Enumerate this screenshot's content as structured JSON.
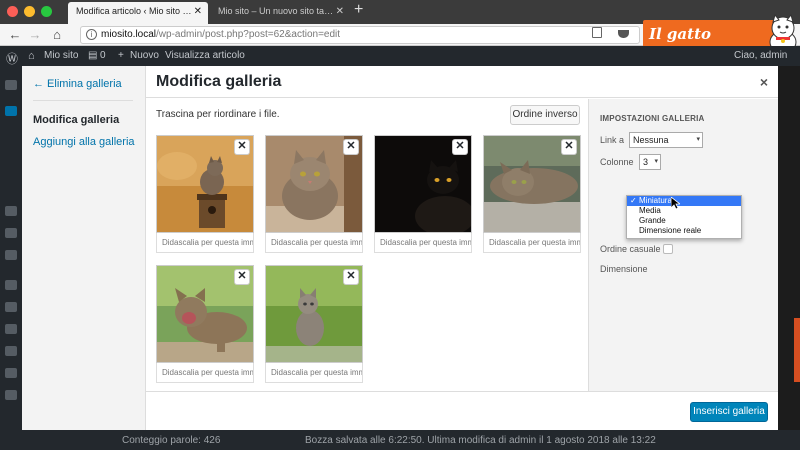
{
  "browser": {
    "tabs": [
      {
        "title": "Modifica articolo ‹ Mio sito — WordPress",
        "active": true
      },
      {
        "title": "Mio sito – Un nuovo sito targato WordPress",
        "active": false
      }
    ],
    "new_tab": "+",
    "url_host": "miosito.local",
    "url_path": "/wp-admin/post.php?post=62&action=edit"
  },
  "logo": {
    "text": "Il gatto WordPress",
    "color": "#ef6a1f"
  },
  "adminbar": {
    "site": "Mio sito",
    "comments": "0",
    "new": "Nuovo",
    "view": "Visualizza articolo",
    "greeting": "Ciao, admin"
  },
  "menu": {
    "back": "← Elimina galleria",
    "current": "Modifica galleria",
    "add": "Aggiungi alla galleria"
  },
  "header": {
    "title": "Modifica galleria",
    "close": "×"
  },
  "content": {
    "instructions": "Trascina per riordinare i file.",
    "reverse_button": "Ordine inverso",
    "remove_symbol": "✕",
    "caption_placeholder": "Didascalia per questa immagine"
  },
  "images": [
    {
      "name": "cat-on-birdhouse"
    },
    {
      "name": "tabby-cat-portrait"
    },
    {
      "name": "black-cat"
    },
    {
      "name": "cat-lying-on-wall"
    },
    {
      "name": "cat-yawning"
    },
    {
      "name": "kitten-in-grass"
    }
  ],
  "settings": {
    "title": "IMPOSTAZIONI GALLERIA",
    "link_label": "Link a",
    "link_value": "Nessuna",
    "columns_label": "Colonne",
    "columns_value": "3",
    "random_label": "Ordine casuale",
    "size_label": "Dimensione",
    "size_options": [
      "Miniatura",
      "Media",
      "Grande",
      "Dimensione reale"
    ],
    "size_selected": "Miniatura"
  },
  "footer": {
    "insert_button": "Inserisci galleria"
  },
  "status": {
    "word_count": "Conteggio parole: 426",
    "draft": "Bozza salvata alle 6:22:50. Ultima modifica di admin il 1 agosto 2018 alle 13:22"
  },
  "colors": {
    "primary": "#0085ba",
    "link": "#0073aa",
    "adminbar": "#23282d",
    "select_highlight": "#3478f6"
  }
}
